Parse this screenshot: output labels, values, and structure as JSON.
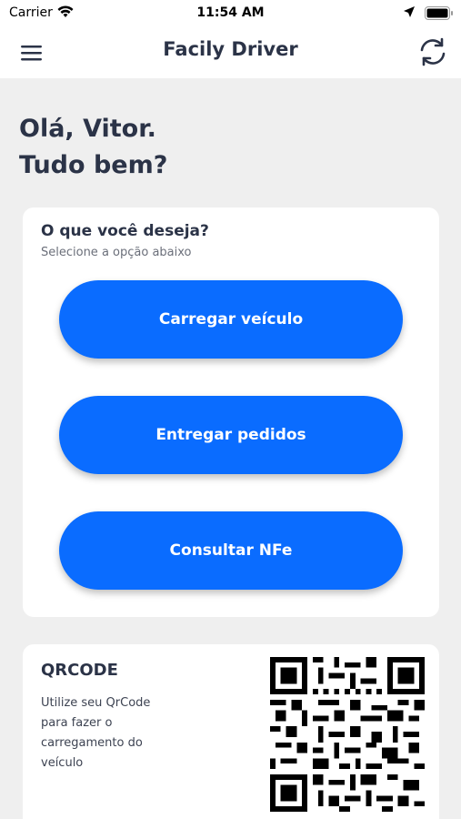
{
  "status_bar": {
    "carrier": "Carrier",
    "time": "11:54 AM"
  },
  "nav": {
    "title": "Facily Driver",
    "menu_icon": "hamburger-menu-icon",
    "refresh_icon": "refresh-icon"
  },
  "greeting": {
    "line1": "Olá, Vitor.",
    "line2": "Tudo bem?"
  },
  "options_card": {
    "heading": "O que você deseja?",
    "subheading": "Selecione a opção abaixo",
    "buttons": [
      {
        "label": "Carregar veículo"
      },
      {
        "label": "Entregar pedidos"
      },
      {
        "label": "Consultar NFe"
      }
    ]
  },
  "qr_card": {
    "heading": "QRCODE",
    "description": "Utilize seu QrCode para fazer o carregamento do veículo"
  },
  "colors": {
    "primary_button": "#0a6cff",
    "title_text": "#2b3347",
    "background": "#efefef"
  }
}
